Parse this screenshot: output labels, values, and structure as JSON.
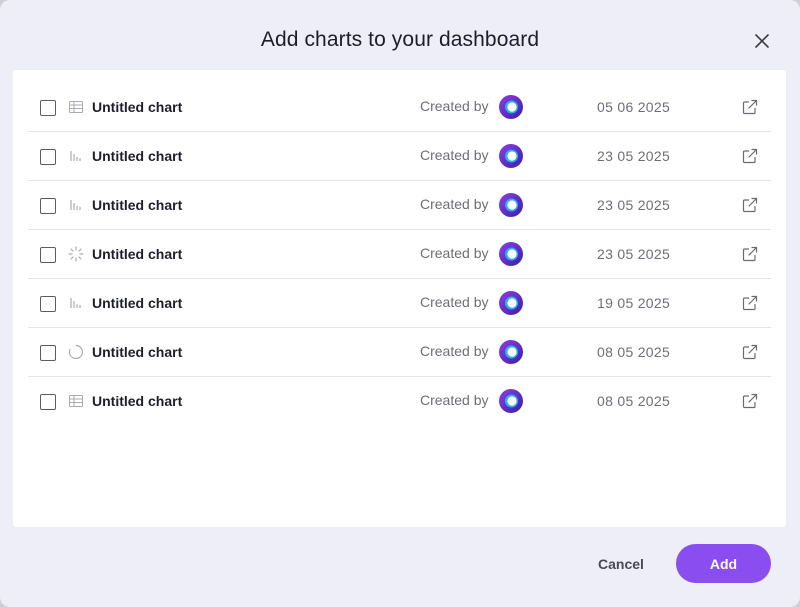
{
  "dialog": {
    "title": "Add charts to your dashboard"
  },
  "charts": [
    {
      "icon": "table-icon",
      "name": "Untitled chart",
      "created_by_label": "Created by",
      "date": "05 06 2025"
    },
    {
      "icon": "bar-chart-icon",
      "name": "Untitled chart",
      "created_by_label": "Created by",
      "date": "23 05 2025"
    },
    {
      "icon": "bar-chart-icon",
      "name": "Untitled chart",
      "created_by_label": "Created by",
      "date": "23 05 2025"
    },
    {
      "icon": "loading-spinner-icon",
      "name": "Untitled chart",
      "created_by_label": "Created by",
      "date": "23 05 2025"
    },
    {
      "icon": "bar-chart-icon",
      "name": "Untitled chart",
      "created_by_label": "Created by",
      "date": "19 05 2025"
    },
    {
      "icon": "donut-chart-icon",
      "name": "Untitled chart",
      "created_by_label": "Created by",
      "date": "08 05 2025"
    },
    {
      "icon": "table-icon",
      "name": "Untitled chart",
      "created_by_label": "Created by",
      "date": "08 05 2025"
    }
  ],
  "footer": {
    "cancel_label": "Cancel",
    "add_label": "Add"
  },
  "colors": {
    "accent": "#8a4df0",
    "avatar_outer": "#6a2fd6",
    "avatar_inner": "#1fa3d9",
    "background": "#eeeef8"
  }
}
